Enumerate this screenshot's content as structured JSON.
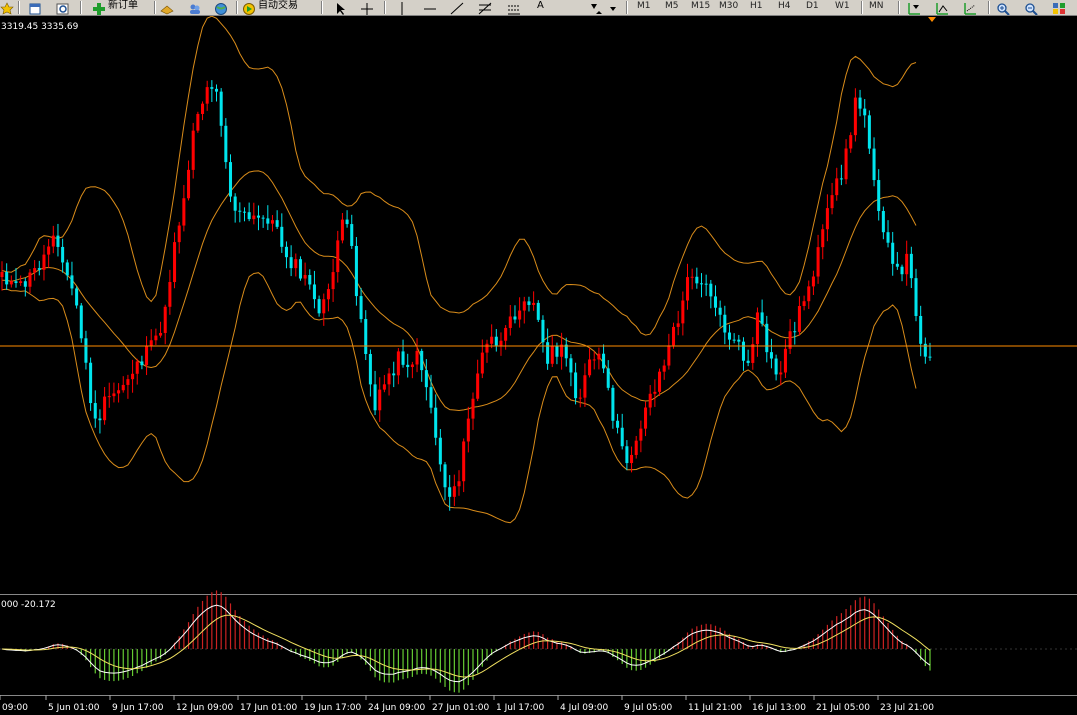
{
  "toolbar": {
    "new_order_label": "新订单",
    "auto_trading_label": "自动交易",
    "text_tool_label": "A",
    "timeframes": [
      "M1",
      "M5",
      "M15",
      "M30",
      "H1",
      "H4",
      "D1",
      "W1",
      "MN"
    ],
    "icons": [
      "star-icon",
      "folder-icon",
      "zoom-icon",
      "new-order-icon",
      "gold-icon",
      "users-icon",
      "globe-icon",
      "auto-trading-icon",
      "cursor-icon",
      "crosshair-icon",
      "vertical-line-icon",
      "horizontal-line-icon",
      "trendline-icon",
      "fibonacci-icon",
      "channel-icon",
      "text-icon",
      "arrows-icon",
      "chart-shift-icon",
      "autoscroll-icon",
      "grid-icon",
      "zoom-in-icon",
      "zoom-out-icon",
      "tile-windows-icon"
    ]
  },
  "main_chart": {
    "price_readout": "3319.45 3335.69",
    "colors": {
      "background": "#000000",
      "bull_candle": "#ff0000",
      "bear_candle": "#00e5ee",
      "bands": "#d98c1a",
      "price_line": "#ff8c00"
    }
  },
  "sub_chart": {
    "readout": "000 -20.172",
    "colors": {
      "positive_hist": "#cc2222",
      "negative_hist": "#66cc33",
      "main_line": "#ffffff",
      "signal_line": "#f0e060"
    }
  },
  "time_axis": {
    "labels": [
      "09:00",
      "5 Jun 01:00",
      "9 Jun 17:00",
      "12 Jun 09:00",
      "17 Jun 01:00",
      "19 Jun 17:00",
      "24 Jun 09:00",
      "27 Jun 01:00",
      "1 Jul 17:00",
      "4 Jul 09:00",
      "9 Jul 05:00",
      "11 Jul 21:00",
      "16 Jul 13:00",
      "21 Jul 05:00",
      "23 Jul 21:00"
    ]
  }
}
